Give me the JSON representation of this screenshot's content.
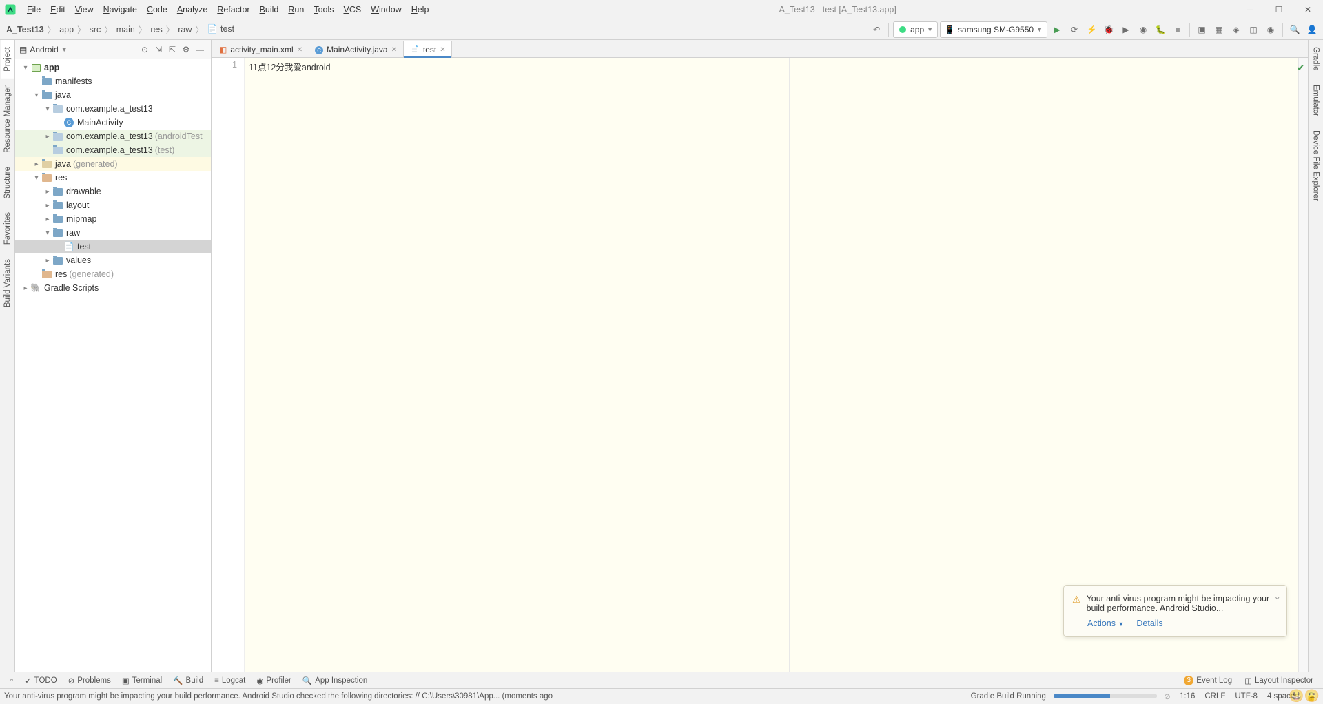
{
  "menu": {
    "items": [
      "File",
      "Edit",
      "View",
      "Navigate",
      "Code",
      "Analyze",
      "Refactor",
      "Build",
      "Run",
      "Tools",
      "VCS",
      "Window",
      "Help"
    ],
    "title": "A_Test13 - test [A_Test13.app]"
  },
  "breadcrumb": [
    "A_Test13",
    "app",
    "src",
    "main",
    "res",
    "raw",
    "test"
  ],
  "runconfig": {
    "label": "app"
  },
  "device": {
    "label": "samsung SM-G9550"
  },
  "projectPanel": {
    "title": "Android"
  },
  "tree": [
    {
      "d": 0,
      "arrow": "▾",
      "icon": "module",
      "label": "app",
      "bold": true
    },
    {
      "d": 1,
      "arrow": "",
      "icon": "folder",
      "label": "manifests"
    },
    {
      "d": 1,
      "arrow": "▾",
      "icon": "folder",
      "label": "java"
    },
    {
      "d": 2,
      "arrow": "▾",
      "icon": "pkg",
      "label": "com.example.a_test13"
    },
    {
      "d": 3,
      "arrow": "",
      "icon": "class",
      "label": "MainActivity"
    },
    {
      "d": 2,
      "arrow": "▸",
      "icon": "pkg",
      "label": "com.example.a_test13",
      "suffix": "(androidTest",
      "cls": "hl1"
    },
    {
      "d": 2,
      "arrow": "",
      "icon": "pkg",
      "label": "com.example.a_test13",
      "suffix": "(test)",
      "cls": "hl1"
    },
    {
      "d": 1,
      "arrow": "▸",
      "icon": "genpkg",
      "label": "java",
      "suffix": "(generated)",
      "cls": "hl2"
    },
    {
      "d": 1,
      "arrow": "▾",
      "icon": "resfolder",
      "label": "res"
    },
    {
      "d": 2,
      "arrow": "▸",
      "icon": "folder",
      "label": "drawable"
    },
    {
      "d": 2,
      "arrow": "▸",
      "icon": "folder",
      "label": "layout"
    },
    {
      "d": 2,
      "arrow": "▸",
      "icon": "folder",
      "label": "mipmap"
    },
    {
      "d": 2,
      "arrow": "▾",
      "icon": "folder",
      "label": "raw"
    },
    {
      "d": 3,
      "arrow": "",
      "icon": "file",
      "label": "test",
      "cls": "sel"
    },
    {
      "d": 2,
      "arrow": "▸",
      "icon": "folder",
      "label": "values"
    },
    {
      "d": 1,
      "arrow": "",
      "icon": "resfolder",
      "label": "res",
      "suffix": "(generated)"
    },
    {
      "d": 0,
      "arrow": "▸",
      "icon": "gradle",
      "label": "Gradle Scripts"
    }
  ],
  "tabs": [
    {
      "icon": "xml",
      "label": "activity_main.xml",
      "active": false
    },
    {
      "icon": "java",
      "label": "MainActivity.java",
      "active": false
    },
    {
      "icon": "file",
      "label": "test",
      "active": true
    }
  ],
  "editor": {
    "lineNumbers": [
      "1"
    ],
    "content": "11点12分我爱android"
  },
  "leftGutter": [
    "Project",
    "Resource Manager",
    "Structure",
    "Favorites",
    "Build Variants"
  ],
  "rightGutter": [
    "Gradle",
    "Emulator",
    "Device File Explorer"
  ],
  "bottomTabs": {
    "left": [
      "TODO",
      "Problems",
      "Terminal",
      "Build",
      "Logcat",
      "Profiler",
      "App Inspection"
    ],
    "rightBadge": "3",
    "rightItems": [
      "Event Log",
      "Layout Inspector"
    ]
  },
  "notif": {
    "text": "Your anti-virus program might be impacting your build performance. Android Studio...",
    "actions": [
      "Actions",
      "Details"
    ]
  },
  "status": {
    "msg": "Your anti-virus program might be impacting your build performance. Android Studio checked the following directories: // C:\\Users\\30981\\App... (moments ago",
    "build": "Gradle Build Running",
    "pos": "1:16",
    "eol": "CRLF",
    "enc": "UTF-8",
    "indent": "4 spaces"
  }
}
